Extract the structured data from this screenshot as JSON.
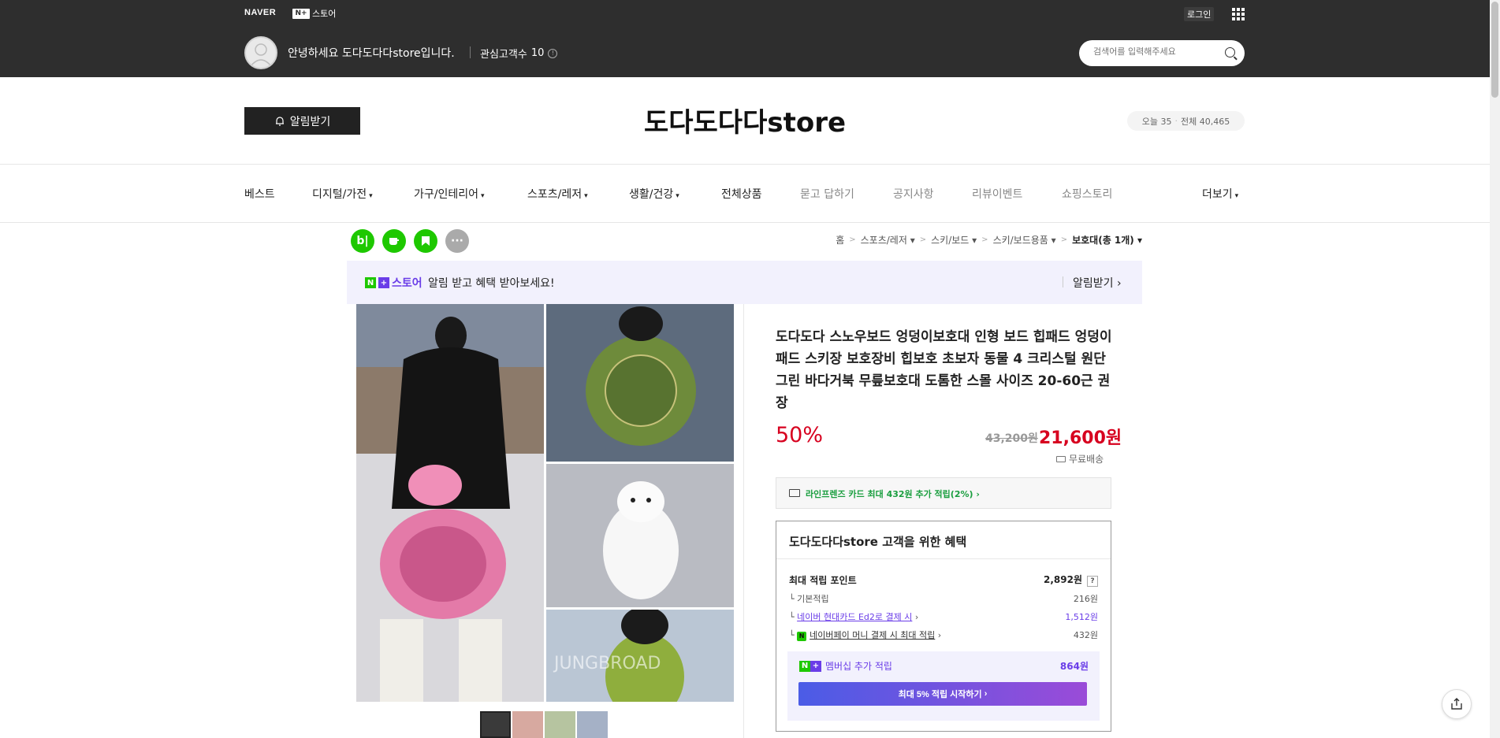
{
  "topbar": {
    "naver_logo": "NAVER",
    "store_logo_text": "스토어",
    "store_logo_mark": "N+",
    "login_label": "로그인",
    "greeting": "안녕하세요 도다도다다store입니다.",
    "interest_label": "관심고객수",
    "interest_count": "10",
    "search_placeholder": "검색어를 입력해주세요"
  },
  "header": {
    "alarm_label": "알림받기",
    "store_title": "도다도다다store",
    "visits_today": "오늘 35",
    "visits_total": "전체 40,465"
  },
  "nav": {
    "items": [
      {
        "label": "베스트",
        "dropdown": false
      },
      {
        "label": "디지털/가전",
        "dropdown": true
      },
      {
        "label": "가구/인테리어",
        "dropdown": true
      },
      {
        "label": "스포츠/레저",
        "dropdown": true
      },
      {
        "label": "생활/건강",
        "dropdown": true
      },
      {
        "label": "전체상품",
        "dropdown": false
      },
      {
        "label": "묻고 답하기",
        "dropdown": false
      },
      {
        "label": "공지사항",
        "dropdown": false
      },
      {
        "label": "리뷰이벤트",
        "dropdown": false
      },
      {
        "label": "쇼핑스토리",
        "dropdown": false
      }
    ],
    "more_label": "더보기"
  },
  "sns_icons": [
    "blog-icon",
    "talk-icon",
    "bookmark-icon",
    "more-icon"
  ],
  "breadcrumb": {
    "home": "홈",
    "level1": "스포츠/레저",
    "level2": "스키/보드",
    "level3": "스키/보드용품",
    "current": "보호대(총 1개)"
  },
  "banner": {
    "store_word": "스토어",
    "text": "알림 받고 혜택 받아보세요!",
    "alarm_label": "알림받기"
  },
  "product": {
    "title": "도다도다 스노우보드 엉덩이보호대 인형 보드 힙패드 엉덩이 패드 스키장 보호장비 힙보호 초보자 동물 4 크리스털 원단 그린 바다거북 무릎보호대 도톰한 스몰 사이즈 20-60근 권장",
    "discount": "50%",
    "original_price": "43,200원",
    "sale_price": "21,600원",
    "delivery": "무료배송",
    "card_benefit": "라인프렌즈 카드 최대 432원 추가 적립(2%)",
    "image_watermark": "JUNGBROAD"
  },
  "benefits": {
    "title": "도다도다다store 고객을 위한 혜택",
    "max_points_label": "최대 적립 포인트",
    "max_points_value": "2,892원",
    "help_mark": "?",
    "basic_label": "기본적립",
    "basic_value": "216원",
    "card_label": "네이버 현대카드 Ed2로 결제 시",
    "card_value": "1,512원",
    "npay_label": "네이버페이 머니 결제 시 최대 적립",
    "npay_mark": "N",
    "npay_value": "432원",
    "member_label": "멤버십 추가 적립",
    "member_value": "864원",
    "member_button": "최대 5% 적립 시작하기"
  },
  "colors": {
    "topbar": "#2e2e2e",
    "price_red": "#d7001f",
    "naver_green": "#1ec800",
    "purple": "#6a3de8"
  }
}
